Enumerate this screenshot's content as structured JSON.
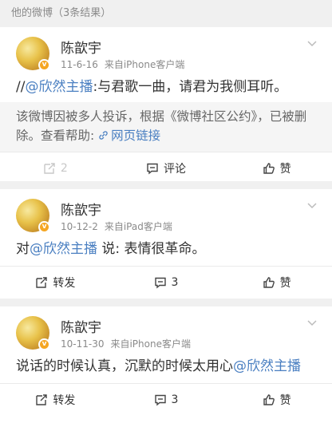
{
  "header": {
    "title": "他的微博（3条结果）"
  },
  "posts": [
    {
      "user": "陈歆宇",
      "date": "11-6-16",
      "source": "来自iPhone客户端",
      "text_prefix": "//",
      "mention": "@欣然主播",
      "text_suffix": ":与君歌一曲，请君为我侧耳听。",
      "notice": "该微博因被多人投诉，根据《微博社区公约》，已被删除。查看帮助: ",
      "notice_link": "网页链接",
      "actions": {
        "repost": "2",
        "comment": "评论",
        "like": "赞"
      }
    },
    {
      "user": "陈歆宇",
      "date": "10-12-2",
      "source": "来自iPad客户端",
      "text_prefix": "对",
      "mention": "@欣然主播",
      "text_suffix": " 说: 表情很革命。",
      "actions": {
        "repost": "转发",
        "comment": "3",
        "like": "赞"
      }
    },
    {
      "user": "陈歆宇",
      "date": "10-11-30",
      "source": "来自iPhone客户端",
      "text_prefix": "说话的时候认真，沉默的时候太用心",
      "mention": "@欣然主播",
      "text_suffix": "",
      "actions": {
        "repost": "转发",
        "comment": "3",
        "like": "赞"
      }
    }
  ]
}
